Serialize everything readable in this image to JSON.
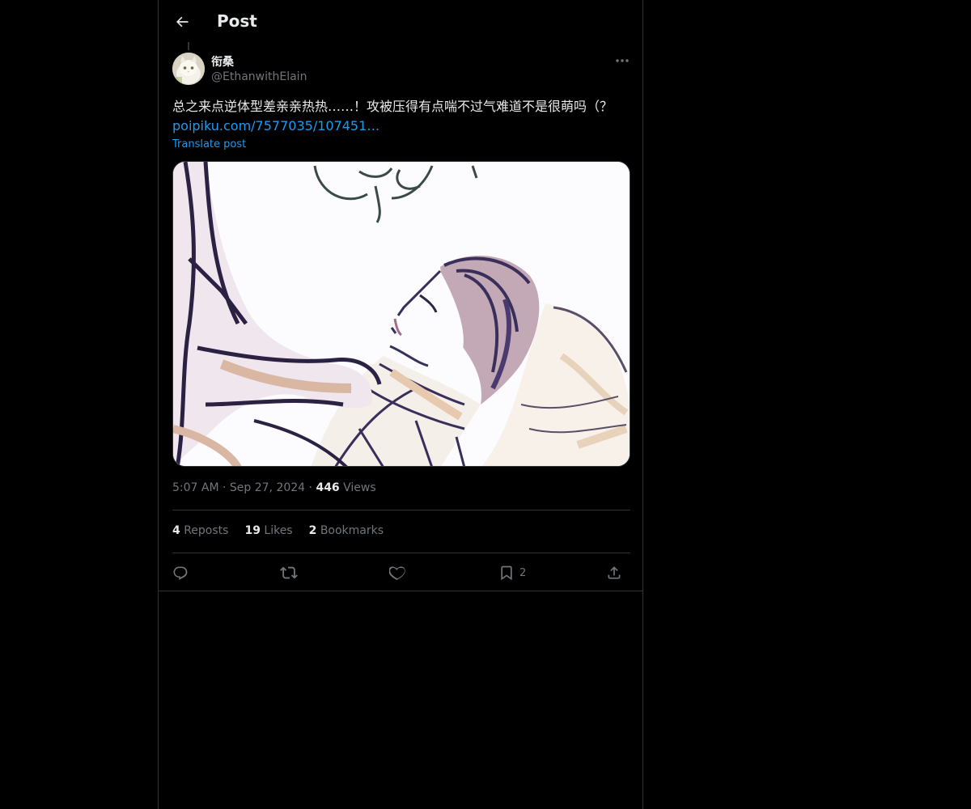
{
  "header": {
    "title": "Post"
  },
  "author": {
    "name": "衔桑",
    "handle": "@EthanwithElain"
  },
  "post": {
    "text": "总之来点逆体型差亲亲热热……！攻被压得有点喘不过气难道不是很萌吗（？",
    "link_text": "poipiku.com/7577035/107451…",
    "translate_label": "Translate post"
  },
  "meta": {
    "time": "5:07 AM",
    "separator": "·",
    "date": "Sep 27, 2024",
    "views_count": "446",
    "views_label": "Views"
  },
  "stats": {
    "reposts_count": "4",
    "reposts_label": "Reposts",
    "likes_count": "19",
    "likes_label": "Likes",
    "bookmarks_count": "2",
    "bookmarks_label": "Bookmarks"
  },
  "actions": {
    "bookmark_count": "2"
  },
  "icons": [
    "back-arrow-icon",
    "more-icon",
    "reply-icon",
    "repost-icon",
    "like-icon",
    "bookmark-icon",
    "share-icon"
  ],
  "colors": {
    "background": "#000000",
    "text": "#e7e9ea",
    "muted": "#71767b",
    "accent": "#1d9bf0",
    "border": "#2f3336"
  }
}
